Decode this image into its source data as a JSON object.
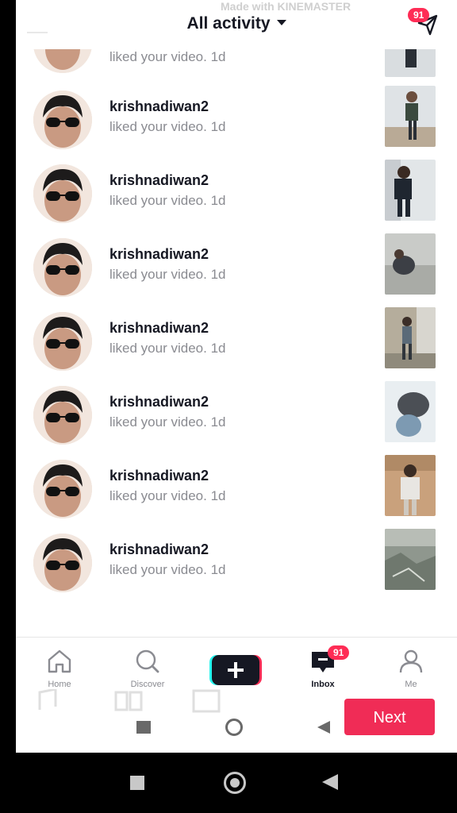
{
  "header": {
    "title": "All activity",
    "watermark": "Made with KINEMASTER",
    "dm_badge": "91"
  },
  "activity": [
    {
      "username": "",
      "message": "liked your video. 1d"
    },
    {
      "username": "krishnadiwan2",
      "message": "liked your video. 1d"
    },
    {
      "username": "krishnadiwan2",
      "message": "liked your video. 1d"
    },
    {
      "username": "krishnadiwan2",
      "message": "liked your video. 1d"
    },
    {
      "username": "krishnadiwan2",
      "message": "liked your video. 1d"
    },
    {
      "username": "krishnadiwan2",
      "message": "liked your video. 1d"
    },
    {
      "username": "krishnadiwan2",
      "message": "liked your video. 1d"
    },
    {
      "username": "krishnadiwan2",
      "message": "liked your video. 1d"
    }
  ],
  "tabs": {
    "home": "Home",
    "discover": "Discover",
    "inbox": "Inbox",
    "inbox_badge": "91",
    "me": "Me"
  },
  "next_button": "Next",
  "colors": {
    "accent": "#fe2c55",
    "text_primary": "#161823",
    "text_secondary": "#8a8b91"
  }
}
